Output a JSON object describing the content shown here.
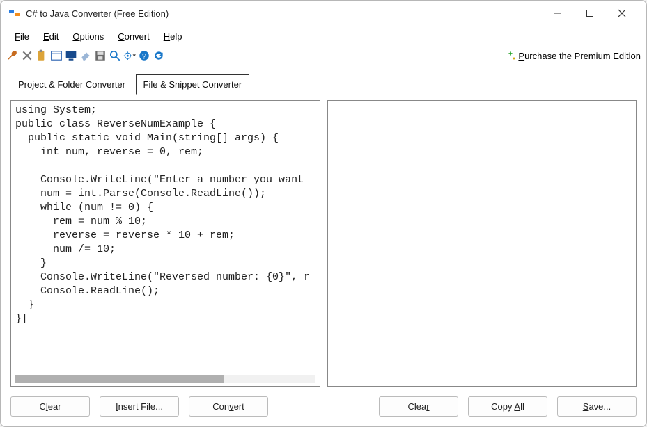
{
  "window": {
    "title": "C# to Java Converter (Free Edition)"
  },
  "menus": [
    "File",
    "Edit",
    "Options",
    "Convert",
    "Help"
  ],
  "menus_accel": [
    0,
    0,
    0,
    0,
    0
  ],
  "premium": {
    "label": "Purchase the Premium Edition"
  },
  "tabs": {
    "project": "Project & Folder Converter",
    "snippet": "File & Snippet Converter",
    "active": "snippet"
  },
  "code": {
    "source": "using System;\npublic class ReverseNumExample {\n  public static void Main(string[] args) {\n    int num, reverse = 0, rem;\n\n    Console.WriteLine(\"Enter a number you want \n    num = int.Parse(Console.ReadLine());\n    while (num != 0) {\n      rem = num % 10;\n      reverse = reverse * 10 + rem;\n      num /= 10;\n    }\n    Console.WriteLine(\"Reversed number: {0}\", r\n    Console.ReadLine();\n  }\n}|",
    "output": ""
  },
  "left_buttons": {
    "clear": "Clear",
    "insert": "Insert File...",
    "convert": "Convert"
  },
  "right_buttons": {
    "clear": "Clear",
    "copyall": "Copy All",
    "save": "Save..."
  },
  "icons": {
    "toolbar": [
      "wrench-icon",
      "delete-icon",
      "paste-icon",
      "window-icon",
      "monitor-icon",
      "eraser-icon",
      "save-icon",
      "search-icon",
      "gear-dropdown-icon",
      "help-icon",
      "refresh-icon"
    ]
  },
  "accel": {
    "left_clear": "l",
    "insert": "I",
    "convert": "v",
    "right_clear": "r",
    "copyall": "A",
    "save": "S"
  }
}
